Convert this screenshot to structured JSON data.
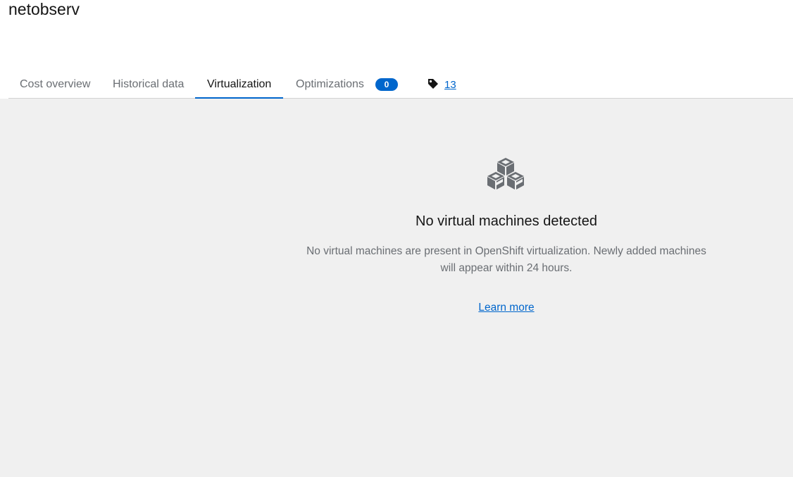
{
  "page": {
    "title": "netobserv"
  },
  "tabs": [
    {
      "label": "Cost overview",
      "active": false
    },
    {
      "label": "Historical data",
      "active": false
    },
    {
      "label": "Virtualization",
      "active": true
    },
    {
      "label": "Optimizations",
      "active": false,
      "badge": "0"
    }
  ],
  "tags": {
    "icon": "tag-icon",
    "count": "13"
  },
  "empty_state": {
    "icon": "cubes-icon",
    "title": "No virtual machines detected",
    "body_line1": "No virtual machines are present in OpenShift virtualization. Newly added machines",
    "body_line2": "will appear within 24 hours.",
    "link": "Learn more"
  },
  "colors": {
    "accent": "#0066cc",
    "content_bg": "#f0f0f0",
    "muted_text": "#6a6e73",
    "icon_gray": "#6a6e73"
  }
}
